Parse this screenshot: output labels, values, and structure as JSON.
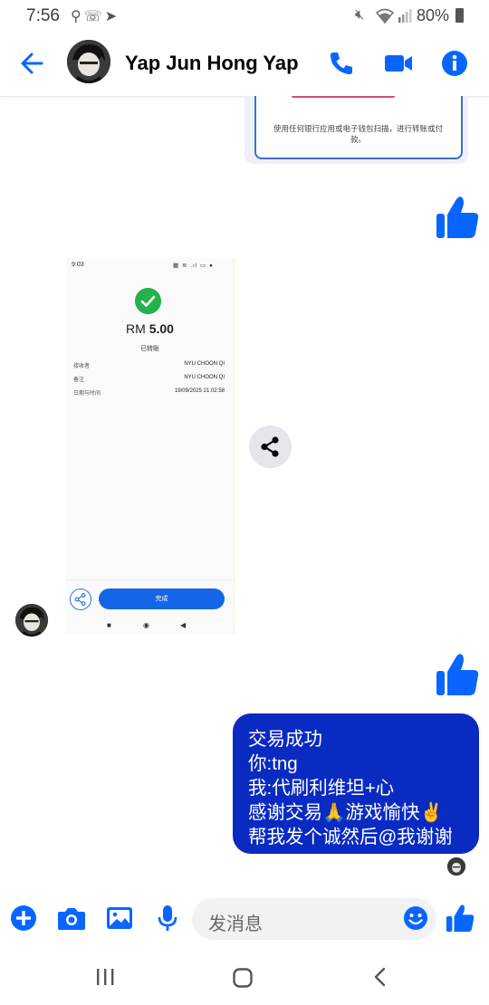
{
  "status_bar": {
    "time": "7:56",
    "battery_text": "80%",
    "left_icons": [
      "link-icon",
      "call-forward-icon",
      "telegram-icon"
    ],
    "right_icons": [
      "mute-icon",
      "wifi-icon",
      "signal-icon",
      "battery-icon"
    ]
  },
  "header": {
    "contact_name": "Yap Jun Hong Yap",
    "icons": [
      "back-arrow-icon",
      "phone-icon",
      "video-camera-icon",
      "info-icon"
    ]
  },
  "messages": {
    "qr_image_caption": "使用任何银行应用或电子钱包扫描，进行转账或付款。",
    "receipt": {
      "time": "9:03",
      "amount_prefix": "RM",
      "amount": "5.00",
      "status": "已转账",
      "rows": [
        {
          "label": "接收者",
          "value": "NYU CHOON QI"
        },
        {
          "label": "备注",
          "value": "NYU CHOON QI"
        },
        {
          "label": "日期与时间",
          "value": "19/09/2025 21:02:58"
        }
      ],
      "done_label": "完成"
    },
    "text_bubble_lines": [
      "交易成功",
      "你:tng",
      "我:代刷利维坦+心",
      "感谢交易🙏游戏愉快✌️",
      "帮我发个诚然后@我谢谢"
    ]
  },
  "composer": {
    "placeholder": "发消息",
    "icons": [
      "plus-icon",
      "camera-icon",
      "gallery-icon",
      "microphone-icon",
      "emoji-icon",
      "thumbs-up-icon"
    ]
  },
  "colors": {
    "accent": "#0866ff",
    "bubble": "#0a2bc2",
    "receipt_check": "#23b24b",
    "receipt_button": "#1366e6"
  }
}
